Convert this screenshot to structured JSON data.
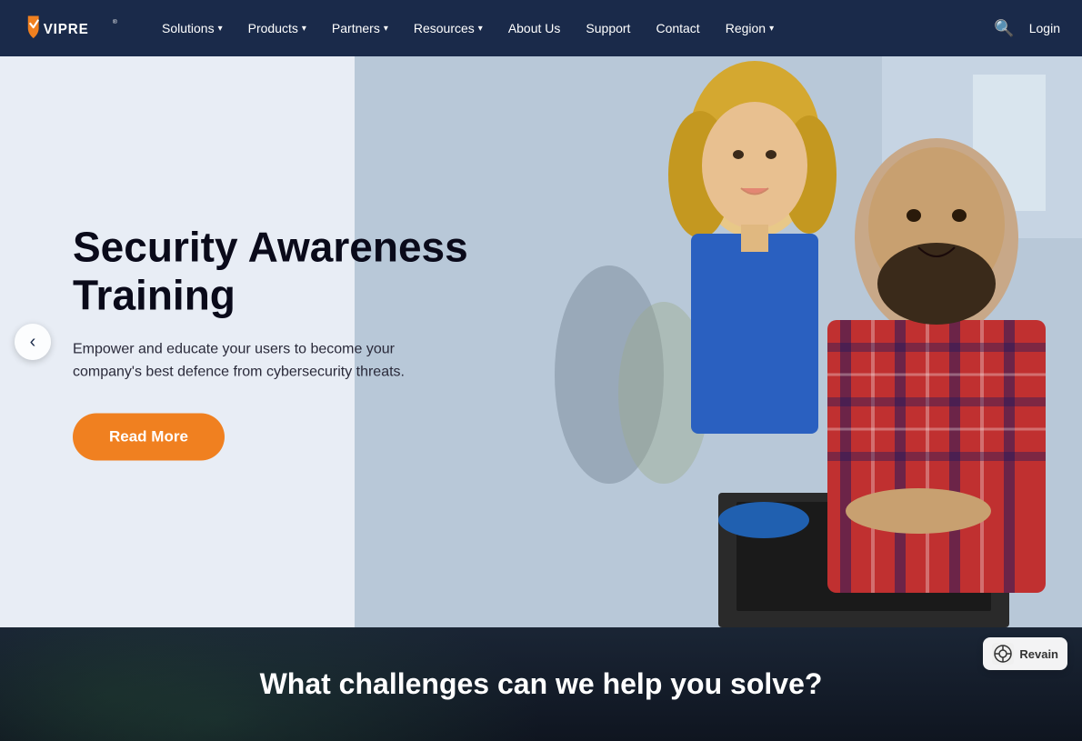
{
  "brand": {
    "name": "VIPRE",
    "logo_text": "VIPRE"
  },
  "navbar": {
    "bg_color": "#1a2a4a",
    "items": [
      {
        "label": "Solutions",
        "has_dropdown": true
      },
      {
        "label": "Products",
        "has_dropdown": true
      },
      {
        "label": "Partners",
        "has_dropdown": true
      },
      {
        "label": "Resources",
        "has_dropdown": true
      },
      {
        "label": "About Us",
        "has_dropdown": false
      },
      {
        "label": "Support",
        "has_dropdown": false
      },
      {
        "label": "Contact",
        "has_dropdown": false
      },
      {
        "label": "Region",
        "has_dropdown": true
      }
    ],
    "search_label": "search",
    "login_label": "Login"
  },
  "hero": {
    "title": "Security Awareness Training",
    "subtitle": "Empower and educate your users to become your company's best defence from cybersecurity threats.",
    "cta_label": "Read More",
    "prev_arrow": "‹"
  },
  "bottom": {
    "text": "What challenges can we help you solve?"
  },
  "revain": {
    "label": "Revain"
  }
}
